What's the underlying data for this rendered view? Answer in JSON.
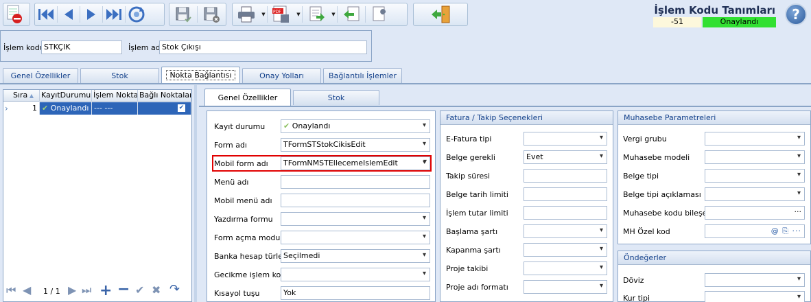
{
  "toolbar": {
    "buttons": [
      "delete-record",
      "first-record",
      "previous-record",
      "next-record",
      "last-record",
      "refresh",
      "save",
      "save-and-close",
      "print",
      "pdf",
      "import-export",
      "back",
      "tools",
      "exit"
    ]
  },
  "header": {
    "title": "İşlem Kodu Tanımları",
    "code_value": "-51",
    "status": "Onaylandı",
    "status_color": "#32e032",
    "help": "?"
  },
  "form": {
    "islem_kodu_label": "İşlem kodu",
    "islem_kodu_value": "STKÇIK",
    "islem_adi_label": "İşlem adı",
    "islem_adi_value": "Stok Çıkışı"
  },
  "tabs": [
    "Genel Özellikler",
    "Stok",
    "Nokta Bağlantısı",
    "Onay Yolları",
    "Bağlantılı İşlemler"
  ],
  "grid": {
    "columns": [
      "Sıra",
      "KayıtDurumu",
      "İşlem Noktası",
      "Bağlı Noktalar"
    ],
    "row": {
      "sira": "1",
      "durum": "Onaylandı",
      "islem_noktasi": "--- ---",
      "bagli": "checked"
    }
  },
  "pager": {
    "text": "1 / 1"
  },
  "subtabs": [
    "Genel Özellikler",
    "Stok"
  ],
  "genel": {
    "rows": [
      {
        "label": "Kayıt durumu",
        "value": "Onaylandı",
        "type": "combo",
        "icon": "check"
      },
      {
        "label": "Form adı",
        "value": "TFormSTStokCikisEdit",
        "type": "combo"
      },
      {
        "label": "Mobil form adı",
        "value": "TFormNMSTEllecemeIslemEdit",
        "type": "combo",
        "highlight": true
      },
      {
        "label": "Menü adı",
        "value": "",
        "type": "text"
      },
      {
        "label": "Mobil menü adı",
        "value": "",
        "type": "text"
      },
      {
        "label": "Yazdırma formu",
        "value": "",
        "type": "combo"
      },
      {
        "label": "Form açma modu",
        "value": "",
        "type": "combo"
      },
      {
        "label": "Banka hesap türleri",
        "value": "Seçilmedi",
        "type": "combo"
      },
      {
        "label": "Gecikme işlem kodu",
        "value": "",
        "type": "combo"
      },
      {
        "label": "Kısayol tuşu",
        "value": "Yok",
        "type": "text"
      }
    ]
  },
  "fatura": {
    "title": "Fatura / Takip Seçenekleri",
    "rows": [
      {
        "label": "E-Fatura tipi",
        "value": "",
        "type": "combo"
      },
      {
        "label": "Belge gerekli",
        "value": "Evet",
        "type": "combo"
      },
      {
        "label": "Takip süresi",
        "value": "",
        "type": "text"
      },
      {
        "label": "Belge tarih limiti",
        "value": "",
        "type": "text"
      },
      {
        "label": "İşlem tutar limiti",
        "value": "",
        "type": "text"
      },
      {
        "label": "Başlama şartı",
        "value": "",
        "type": "combo"
      },
      {
        "label": "Kapanma şartı",
        "value": "",
        "type": "combo"
      },
      {
        "label": "Proje takibi",
        "value": "",
        "type": "combo"
      },
      {
        "label": "Proje adı formatı",
        "value": "",
        "type": "combo"
      }
    ]
  },
  "muhasebe": {
    "title": "Muhasebe Parametreleri",
    "rows": [
      {
        "label": "Vergi grubu",
        "value": "",
        "type": "combo"
      },
      {
        "label": "Muhasebe modeli",
        "value": "",
        "type": "combo"
      },
      {
        "label": "Belge tipi",
        "value": "",
        "type": "combo"
      },
      {
        "label": "Belge tipi açıklaması",
        "value": "",
        "type": "combo"
      },
      {
        "label": "Muhasebe kodu bileşeni",
        "value": "",
        "type": "dots"
      },
      {
        "label": "MH Özel kod",
        "value": "",
        "type": "special"
      }
    ]
  },
  "ondeger": {
    "title": "Öndeğerler",
    "rows": [
      {
        "label": "Döviz",
        "value": "",
        "type": "combo"
      },
      {
        "label": "Kur tipi",
        "value": "",
        "type": "combo"
      }
    ]
  }
}
